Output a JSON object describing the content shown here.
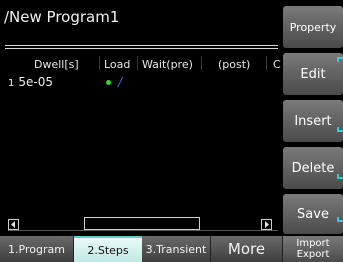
{
  "header": {
    "title": "/New Program1"
  },
  "table": {
    "columns": [
      "Dwell[s]",
      "Load",
      "Wait(pre)",
      "(post)",
      "C"
    ],
    "rows": [
      {
        "index": "1",
        "dwell": "5e-05"
      }
    ],
    "load_indicator_color": "#2fd62f",
    "load_bar_color": "#3f6fd8"
  },
  "scrollbar": {
    "left_arrow_icon": "triangle-left-icon",
    "right_arrow_icon": "triangle-right-icon"
  },
  "tabs": [
    {
      "label": "1.Program",
      "active": false
    },
    {
      "label": "2.Steps",
      "active": true
    },
    {
      "label": "3.Transient",
      "active": false
    },
    {
      "label": "More",
      "active": false
    },
    {
      "label": "Import\nExport",
      "active": false
    }
  ],
  "side_buttons": {
    "property": "Property",
    "edit": "Edit",
    "insert": "Insert",
    "delete": "Delete",
    "save": "Save",
    "import_export": "Import Export"
  },
  "accent_color": "#3cc6e6",
  "active_tab_color": "#bfe9e3"
}
